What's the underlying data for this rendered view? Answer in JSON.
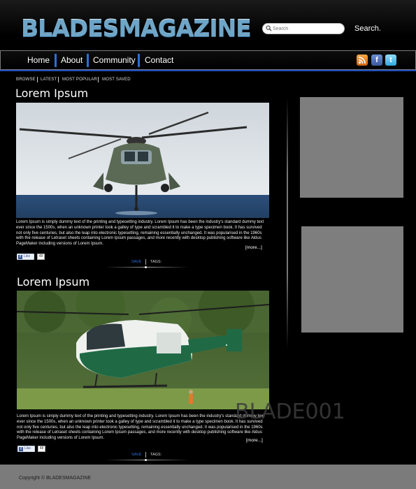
{
  "header": {
    "logo": "BLADESMAGAZINE",
    "search_placeholder": "Search",
    "search_button": "Search."
  },
  "nav": {
    "items": [
      "Home",
      "About",
      "Community",
      "Contact"
    ]
  },
  "social": {
    "rss_icon": "rss-icon",
    "facebook_icon": "facebook-icon",
    "twitter_icon": "twitter-icon"
  },
  "subnav": {
    "items": [
      "BROWSE",
      "LATEST",
      "MOST POPULAR",
      "MOST SAVED"
    ]
  },
  "posts": [
    {
      "title": "Lorem Ipsum",
      "body": "Lorem Ipsum is simply dummy text of the printing and typesetting industry. Lorem Ipsum has been the industry's standard dummy text ever since the 1500s, when an unknown printer took a galley of type and scrambled it to make a type specimen book. It has survived not only five centuries, but also the leap into electronic typesetting, remaining essentially unchanged. It was popularised in the 1960s with the release of Letraset sheets containing Lorem Ipsum passages, and more recently with desktop publishing software like Aldus PageMaker including versions of Lorem Ipsum.",
      "more": "[more...]",
      "like": "Like",
      "count": "48",
      "save": "SAVE",
      "tags": "TAGS:"
    },
    {
      "title": "Lorem Ipsum",
      "body": "Lorem Ipsum is simply dummy text of the printing and typesetting industry. Lorem Ipsum has been the industry's standard dummy text ever since the 1500s, when an unknown printer took a galley of type and scrambled it to make a type specimen book. It has survived not only five centuries, but also the leap into electronic typesetting, remaining essentially unchanged. It was popularised in the 1960s with the release of Letraset sheets containing Lorem Ipsum passages, and more recently with desktop publishing software like Aldus PageMaker including versions of Lorem Ipsum.",
      "more": "[more...]",
      "like": "Like",
      "count": "48",
      "save": "SAVE",
      "tags": "TAGS:"
    }
  ],
  "watermark": "BLADE001",
  "footer": {
    "copyright": "Copyright © BLADESMAGAZINE"
  },
  "colors": {
    "accent_blue": "#2c6fd6",
    "ad_gray": "#7e7e7e",
    "footer_gray": "#7b7b7b"
  }
}
